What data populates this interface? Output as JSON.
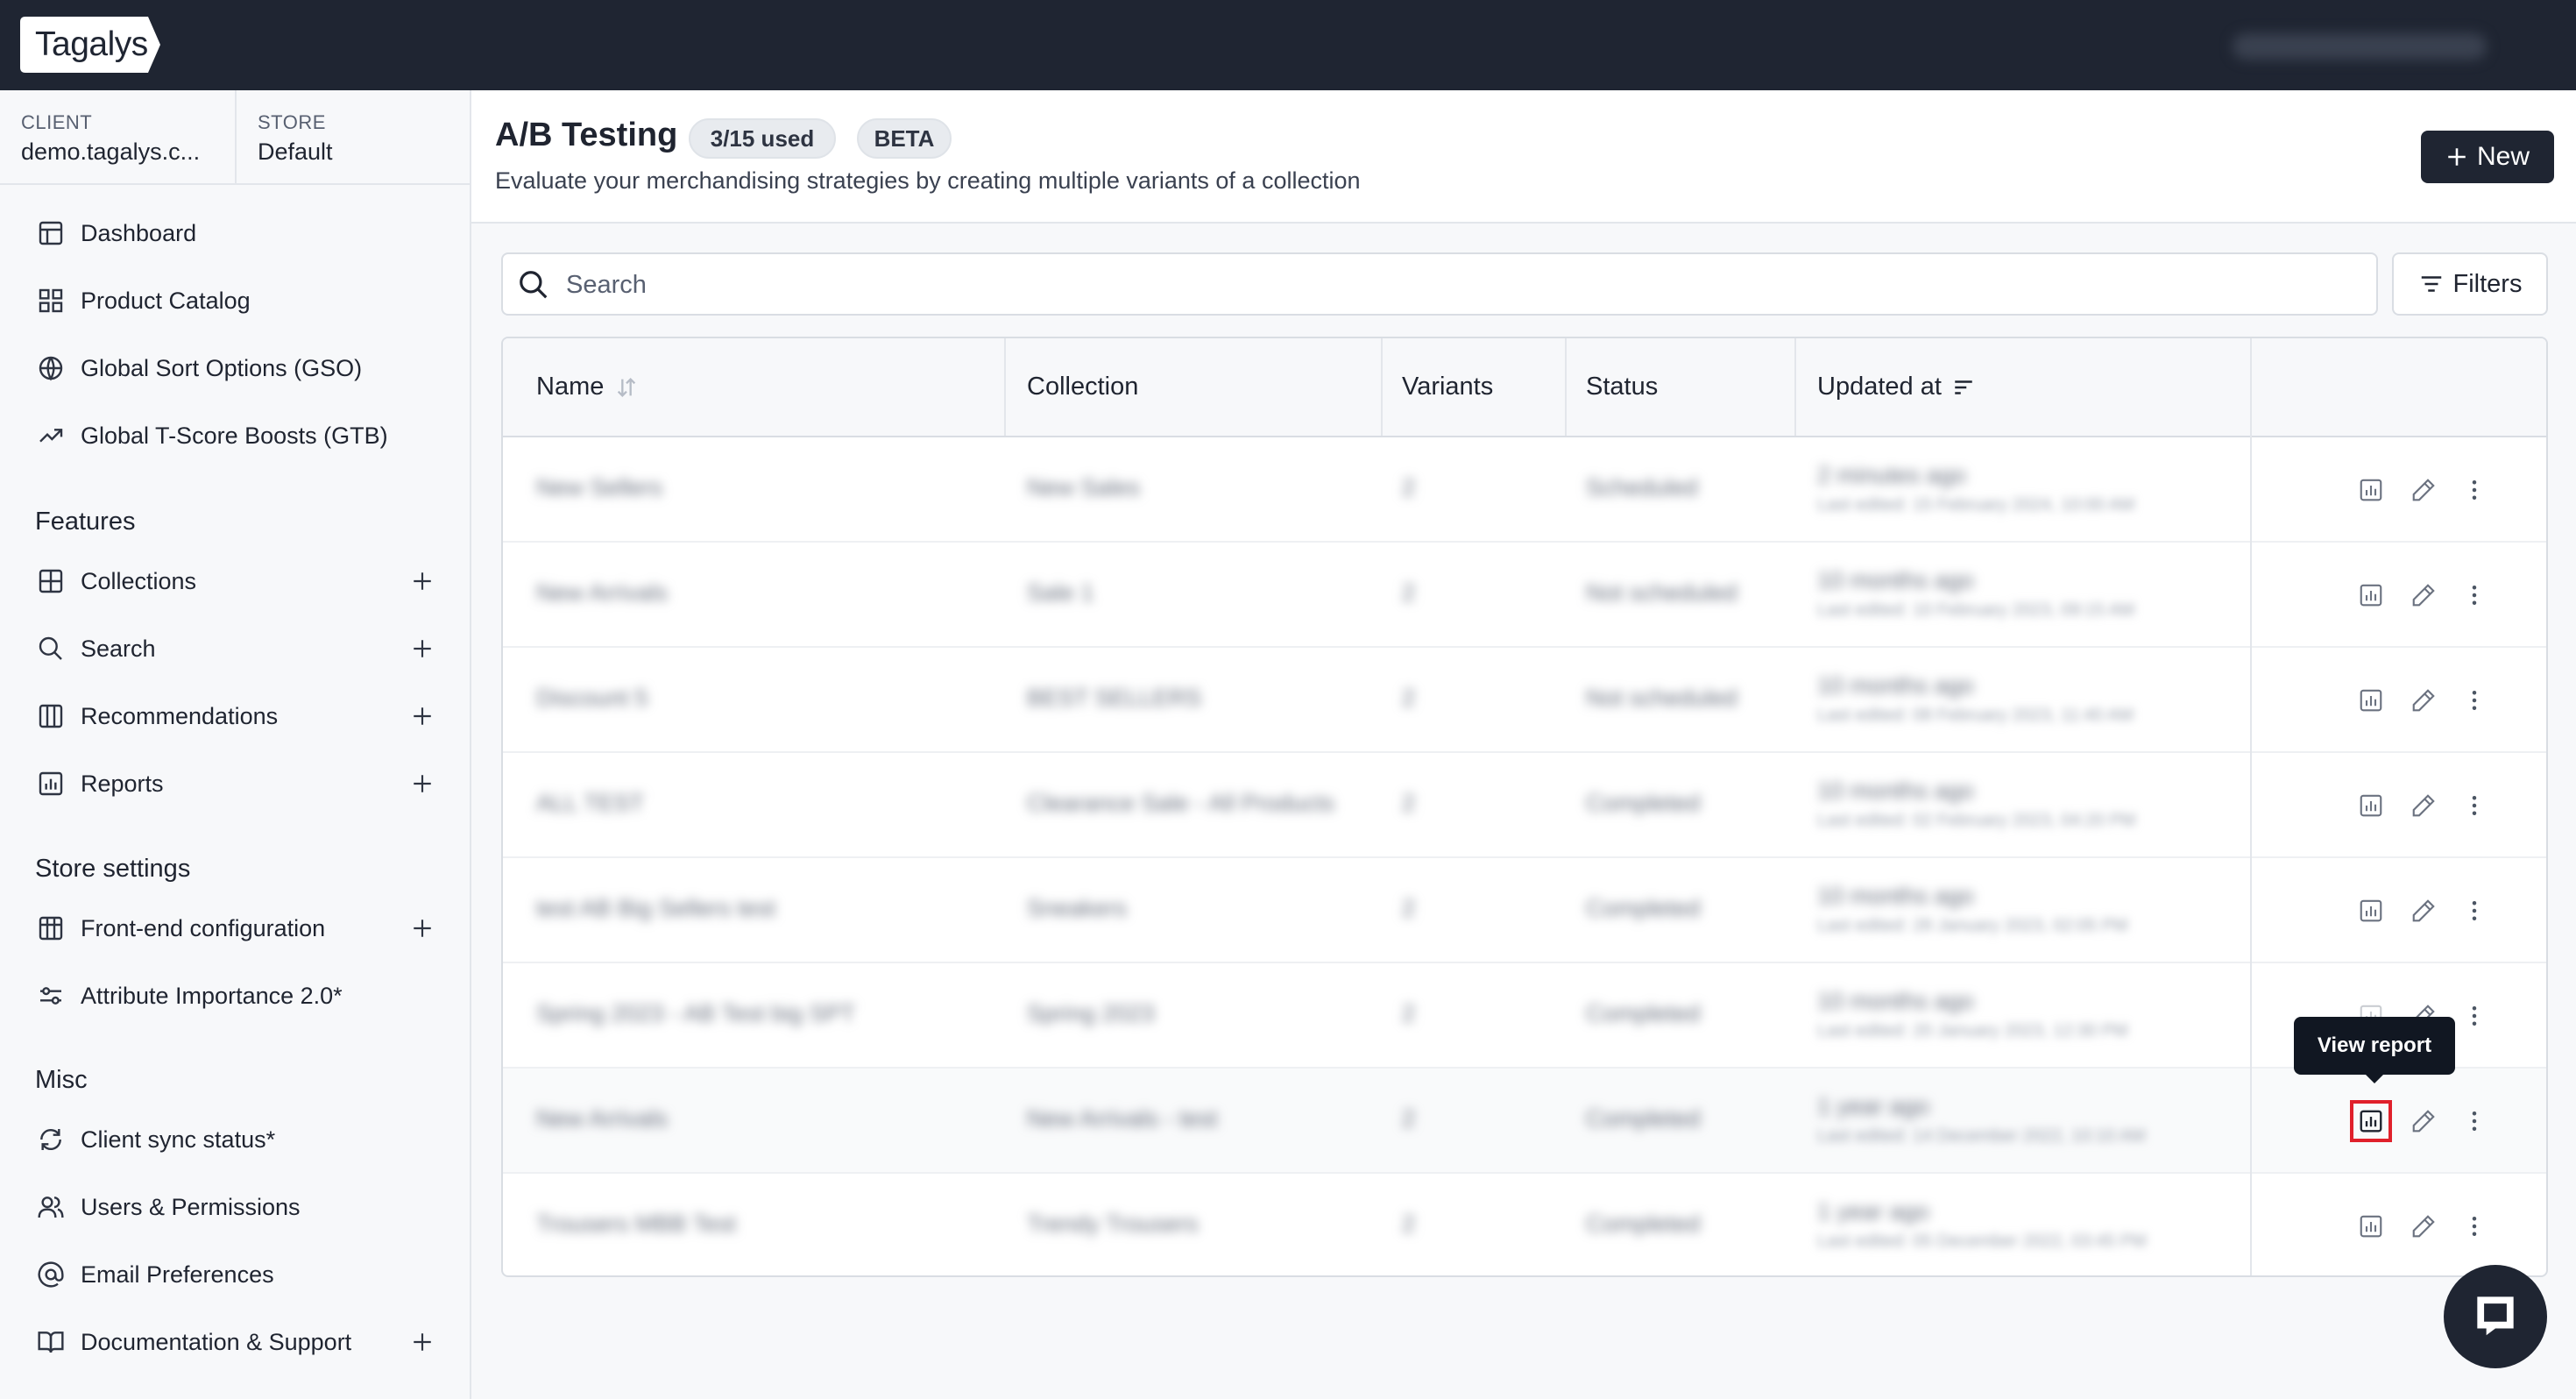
{
  "app": {
    "logo_text": "Tagalys"
  },
  "context": {
    "client_label": "CLIENT",
    "client_value": "demo.tagalys.c...",
    "store_label": "STORE",
    "store_value": "Default"
  },
  "sidebar": {
    "top_items": [
      {
        "label": "Dashboard",
        "icon": "dashboard-icon"
      },
      {
        "label": "Product Catalog",
        "icon": "grid-icon"
      },
      {
        "label": "Global Sort Options (GSO)",
        "icon": "globe-icon"
      },
      {
        "label": "Global T-Score Boosts (GTB)",
        "icon": "trending-up-icon"
      }
    ],
    "features_title": "Features",
    "features": [
      {
        "label": "Collections",
        "icon": "collections-icon"
      },
      {
        "label": "Search",
        "icon": "search-icon"
      },
      {
        "label": "Recommendations",
        "icon": "columns-icon"
      },
      {
        "label": "Reports",
        "icon": "bar-chart-icon"
      }
    ],
    "store_settings_title": "Store settings",
    "store_settings": [
      {
        "label": "Front-end configuration",
        "icon": "table-icon"
      },
      {
        "label": "Attribute Importance 2.0*",
        "icon": "sliders-icon"
      }
    ],
    "misc_title": "Misc",
    "misc": [
      {
        "label": "Client sync status*",
        "icon": "sync-icon"
      },
      {
        "label": "Users & Permissions",
        "icon": "users-icon"
      },
      {
        "label": "Email Preferences",
        "icon": "at-sign-icon"
      },
      {
        "label": "Documentation & Support",
        "icon": "book-icon"
      }
    ]
  },
  "header": {
    "title": "A/B Testing",
    "usage_badge": "3/15 used",
    "beta_badge": "BETA",
    "subtitle": "Evaluate your merchandising strategies by creating multiple variants of a collection",
    "new_button": "New"
  },
  "search": {
    "placeholder": "Search"
  },
  "filters_button": "Filters",
  "table": {
    "columns": [
      "Name",
      "Collection",
      "Variants",
      "Status",
      "Updated at"
    ],
    "rows": [
      {
        "name": "New Sellers",
        "collection": "New Sales",
        "variants": "2",
        "status": "Scheduled",
        "updated": "2 minutes ago",
        "updated_sub": "Last edited: 15 February 2024, 10:00 AM"
      },
      {
        "name": "New Arrivals",
        "collection": "Sale 1",
        "variants": "2",
        "status": "Not scheduled",
        "updated": "10 months ago",
        "updated_sub": "Last edited: 10 February 2023, 09:15 AM"
      },
      {
        "name": "Discount 5",
        "collection": "BEST SELLERS",
        "variants": "2",
        "status": "Not scheduled",
        "updated": "10 months ago",
        "updated_sub": "Last edited: 08 February 2023, 11:40 AM"
      },
      {
        "name": "ALL TEST",
        "collection": "Clearance Sale - All Products",
        "variants": "2",
        "status": "Completed",
        "updated": "10 months ago",
        "updated_sub": "Last edited: 02 February 2023, 04:20 PM"
      },
      {
        "name": "test AB Big Sellers test",
        "collection": "Sneakers",
        "variants": "2",
        "status": "Completed",
        "updated": "10 months ago",
        "updated_sub": "Last edited: 28 January 2023, 02:05 PM"
      },
      {
        "name": "Spring 2023 - AB Test big SPT",
        "collection": "Spring 2023",
        "variants": "2",
        "status": "Completed",
        "updated": "10 months ago",
        "updated_sub": "Last edited: 20 January 2023, 12:30 PM"
      },
      {
        "name": "New Arrivals",
        "collection": "New Arrivals - test",
        "variants": "2",
        "status": "Completed",
        "updated": "1 year ago",
        "updated_sub": "Last edited: 14 December 2022, 10:10 AM"
      },
      {
        "name": "Trousers MBB Test",
        "collection": "Trendy Trousers",
        "variants": "2",
        "status": "Completed",
        "updated": "1 year ago",
        "updated_sub": "Last edited: 05 December 2022, 03:45 PM"
      }
    ]
  },
  "tooltip": {
    "text": "View report"
  }
}
